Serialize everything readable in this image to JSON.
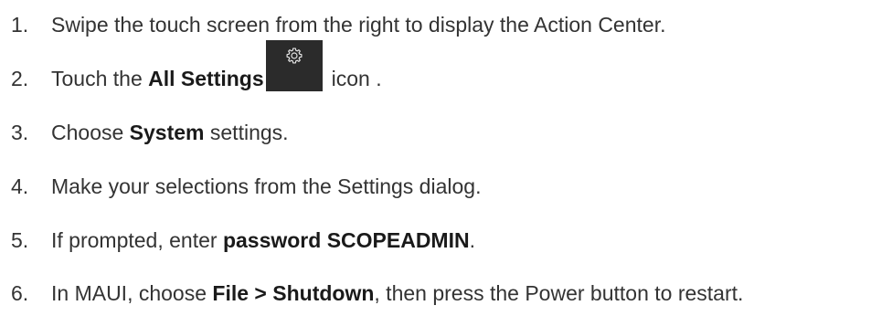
{
  "steps": [
    {
      "number": "1.",
      "text": "Swipe the touch screen from the right to display the Action Center."
    },
    {
      "number": "2.",
      "before": "Touch the ",
      "bold": "All Settings",
      "icon": "gear-icon",
      "after": "icon ."
    },
    {
      "number": "3.",
      "before": "Choose ",
      "bold": "System",
      "after": " settings."
    },
    {
      "number": "4.",
      "text": "Make your selections from the Settings dialog."
    },
    {
      "number": "5.",
      "before": "If prompted, enter ",
      "bold": "password SCOPEADMIN",
      "after": "."
    },
    {
      "number": "6.",
      "before": "In MAUI, choose ",
      "bold": "File > Shutdown",
      "after": ", then press the Power button to restart."
    }
  ],
  "colors": {
    "text": "#333333",
    "icon_tile": "#2b2b2b",
    "icon_glyph": "#e6e6e6"
  }
}
